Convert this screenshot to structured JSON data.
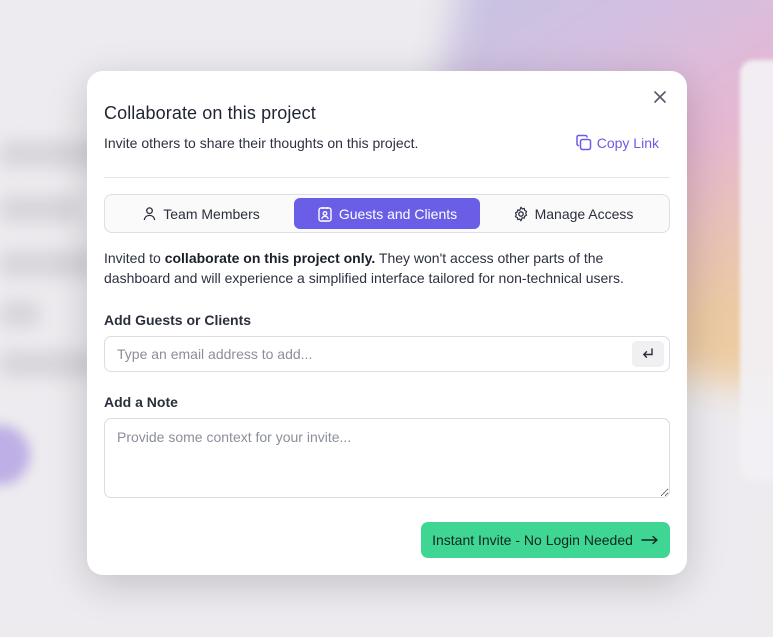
{
  "modal": {
    "title": "Collaborate on this project",
    "subtitle": "Invite others to share their thoughts on this project.",
    "copy_link_label": "Copy Link"
  },
  "tabs": [
    {
      "label": "Team Members",
      "icon": "user-icon",
      "active": false
    },
    {
      "label": "Guests and Clients",
      "icon": "contact-card-icon",
      "active": true
    },
    {
      "label": "Manage Access",
      "icon": "gear-icon",
      "active": false
    }
  ],
  "description": {
    "prefix": "Invited to ",
    "bold": "collaborate on this project only.",
    "suffix": " They won't access other parts of the dashboard and will experience a simplified interface tailored for non-technical users."
  },
  "email": {
    "label": "Add Guests or Clients",
    "placeholder": "Type an email address to add...",
    "value": ""
  },
  "note": {
    "label": "Add a Note",
    "placeholder": "Provide some context for your invite...",
    "value": ""
  },
  "invite_button": {
    "label": "Instant Invite - No Login Needed"
  },
  "colors": {
    "accent": "#6a5ee6",
    "invite_button": "#3fd693"
  }
}
